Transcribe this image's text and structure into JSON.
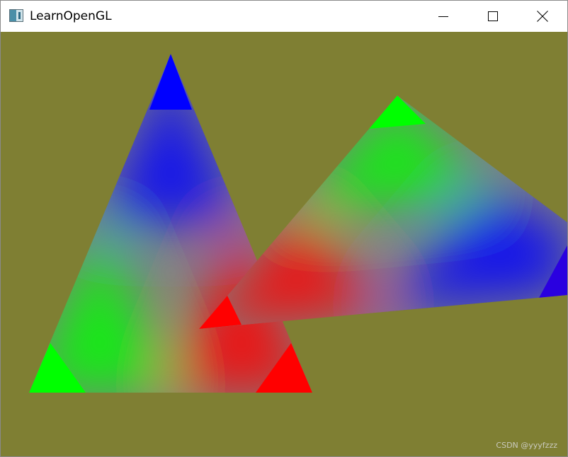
{
  "window": {
    "title": "LearnOpenGL",
    "app_icon": "opengl-window-icon",
    "controls": {
      "minimize_icon": "minimize-icon",
      "maximize_icon": "maximize-icon",
      "close_icon": "close-icon"
    }
  },
  "render": {
    "clear_color": "#7f7f33",
    "triangles": [
      {
        "name": "left-triangle",
        "vertex_colors": [
          "#ff0000",
          "#00ff00",
          "#0000ff"
        ]
      },
      {
        "name": "right-triangle",
        "vertex_colors": [
          "#ff0000",
          "#0000ff",
          "#00ff00"
        ]
      }
    ]
  },
  "watermark": {
    "text": "CSDN @yyyfzzz"
  }
}
